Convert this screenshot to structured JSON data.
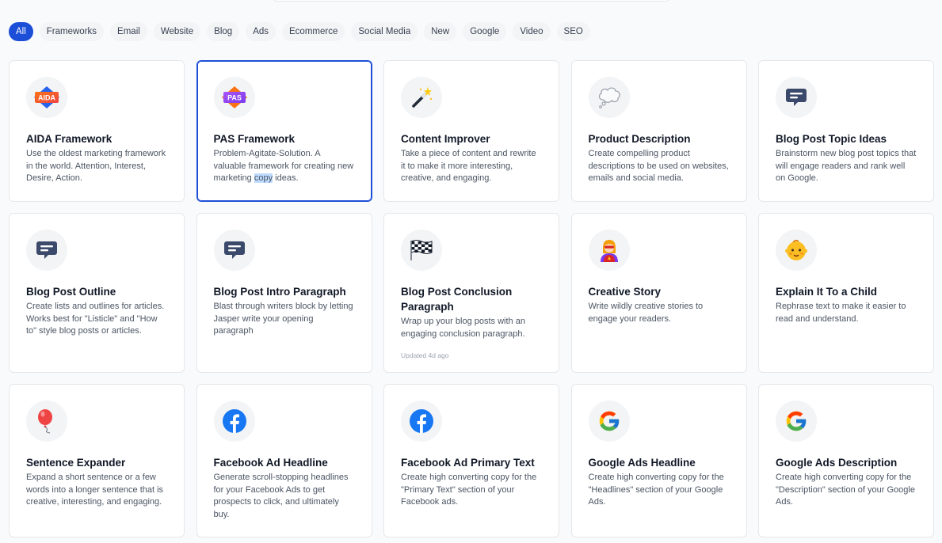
{
  "filters": [
    "All",
    "Frameworks",
    "Email",
    "Website",
    "Blog",
    "Ads",
    "Ecommerce",
    "Social Media",
    "New",
    "Google",
    "Video",
    "SEO"
  ],
  "cards": [
    {
      "title": "AIDA Framework",
      "desc": "Use the oldest marketing framework in the world. Attention, Interest, Desire, Action.",
      "icon": "aida-badge",
      "icon_text": "AIDA"
    },
    {
      "title": "PAS Framework",
      "desc_before": "Problem-Agitate-Solution. A valuable framework for creating new marketing ",
      "desc_highlight": "copy",
      "desc_after": " ideas.",
      "icon": "pas-badge",
      "icon_text": "PAS"
    },
    {
      "title": "Content Improver",
      "desc": "Take a piece of content and rewrite it to make it more interesting, creative, and engaging.",
      "icon": "magic-wand-icon"
    },
    {
      "title": "Product Description",
      "desc": "Create compelling product descriptions to be used on websites, emails and social media.",
      "icon": "thought-bubble-icon"
    },
    {
      "title": "Blog Post Topic Ideas",
      "desc": "Brainstorm new blog post topics that will engage readers and rank well on Google.",
      "icon": "chat-icon"
    },
    {
      "title": "Blog Post Outline",
      "desc": "Create lists and outlines for articles. Works best for \"Listicle\" and \"How to\" style blog posts or articles.",
      "icon": "chat-icon"
    },
    {
      "title": "Blog Post Intro Paragraph",
      "desc": "Blast through writers block by letting Jasper write your opening paragraph",
      "icon": "chat-icon"
    },
    {
      "title": "Blog Post Conclusion Paragraph",
      "desc": "Wrap up your blog posts with an engaging conclusion paragraph.",
      "updated": "Updated 4d ago",
      "icon": "checkered-flag-icon"
    },
    {
      "title": "Creative Story",
      "desc": "Write wildly creative stories to engage your readers.",
      "icon": "superhero-icon"
    },
    {
      "title": "Explain It To a Child",
      "desc": "Rephrase text to make it easier to read and understand.",
      "icon": "baby-icon"
    },
    {
      "title": "Sentence Expander",
      "desc": "Expand a short sentence or a few words into a longer sentence that is creative, interesting, and engaging.",
      "icon": "balloon-icon"
    },
    {
      "title": "Facebook Ad Headline",
      "desc": "Generate scroll-stopping headlines for your Facebook Ads to get prospects to click, and ultimately buy.",
      "icon": "facebook-icon"
    },
    {
      "title": "Facebook Ad Primary Text",
      "desc": "Create high converting copy for the \"Primary Text\" section of your Facebook ads.",
      "icon": "facebook-icon"
    },
    {
      "title": "Google Ads Headline",
      "desc": "Create high converting copy for the \"Headlines\" section of your Google Ads.",
      "icon": "google-icon"
    },
    {
      "title": "Google Ads Description",
      "desc": "Create high converting copy for the \"Description\" section of your Google Ads.",
      "icon": "google-icon"
    }
  ],
  "colors": {
    "accent": "#1d4ed8",
    "facebook": "#1877f2",
    "chat": "#3b4a6b"
  }
}
